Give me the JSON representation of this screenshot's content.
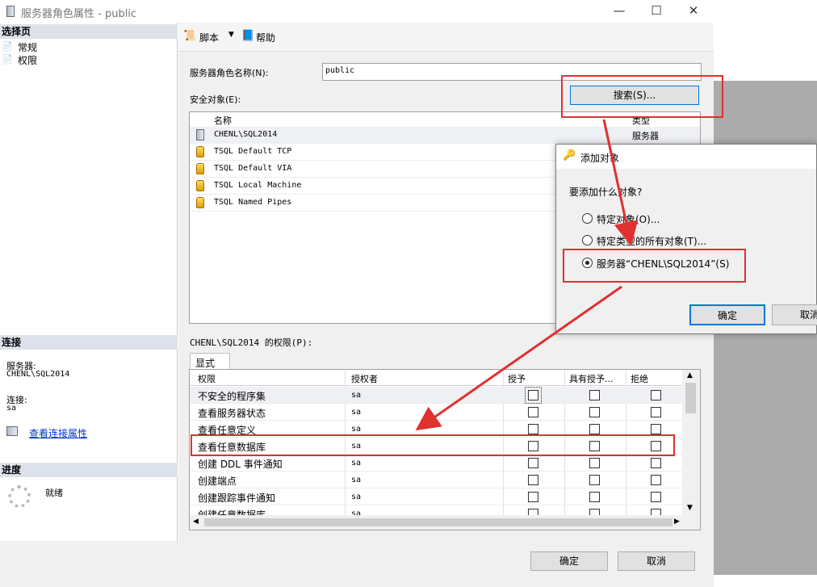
{
  "window": {
    "title": "服务器角色属性 - public"
  },
  "left": {
    "select_page": "选择页",
    "pages": [
      "常规",
      "权限"
    ],
    "connection": "连接",
    "server_label": "服务器:",
    "server_value": "CHENL\\SQL2014",
    "conn_label": "连接:",
    "conn_value": "sa",
    "view_conn": "查看连接属性",
    "progress": "进度",
    "progress_status": "就绪"
  },
  "toolbar": {
    "script": "脚本",
    "help": "帮助"
  },
  "form": {
    "role_name_label": "服务器角色名称(N):",
    "role_name_value": "public",
    "securables_label": "安全对象(E):",
    "search_button": "搜索(S)...",
    "col_name": "名称",
    "col_type": "类型",
    "securables": [
      {
        "name": "CHENL\\SQL2014",
        "type": "服务器"
      },
      {
        "name": "TSQL Default TCP"
      },
      {
        "name": "TSQL Default VIA"
      },
      {
        "name": "TSQL Local Machine"
      },
      {
        "name": "TSQL Named Pipes"
      }
    ],
    "perm_label": "CHENL\\SQL2014 的权限(P):",
    "tab_explicit": "显式",
    "pcols": [
      "权限",
      "授权者",
      "授予",
      "具有授予...",
      "拒绝"
    ],
    "permissions": [
      {
        "name": "不安全的程序集",
        "grantor": "sa"
      },
      {
        "name": "查看服务器状态",
        "grantor": "sa"
      },
      {
        "name": "查看任意定义",
        "grantor": "sa"
      },
      {
        "name": "查看任意数据库",
        "grantor": "sa"
      },
      {
        "name": "创建 DDL 事件通知",
        "grantor": "sa"
      },
      {
        "name": "创建端点",
        "grantor": "sa"
      },
      {
        "name": "创建跟踪事件通知",
        "grantor": "sa"
      },
      {
        "name": "创建任意数据库",
        "grantor": "sa"
      }
    ]
  },
  "buttons": {
    "ok": "确定",
    "cancel": "取消"
  },
  "dialog": {
    "title": "添加对象",
    "question": "要添加什么对象?",
    "options": [
      "特定对象(O)...",
      "特定类型的所有对象(T)...",
      "服务器“CHENL\\SQL2014”(S)"
    ],
    "selected": 2,
    "ok": "确定",
    "cancel": "取消"
  },
  "colors": {
    "highlight": "#e03030",
    "accent": "#0078d7"
  }
}
